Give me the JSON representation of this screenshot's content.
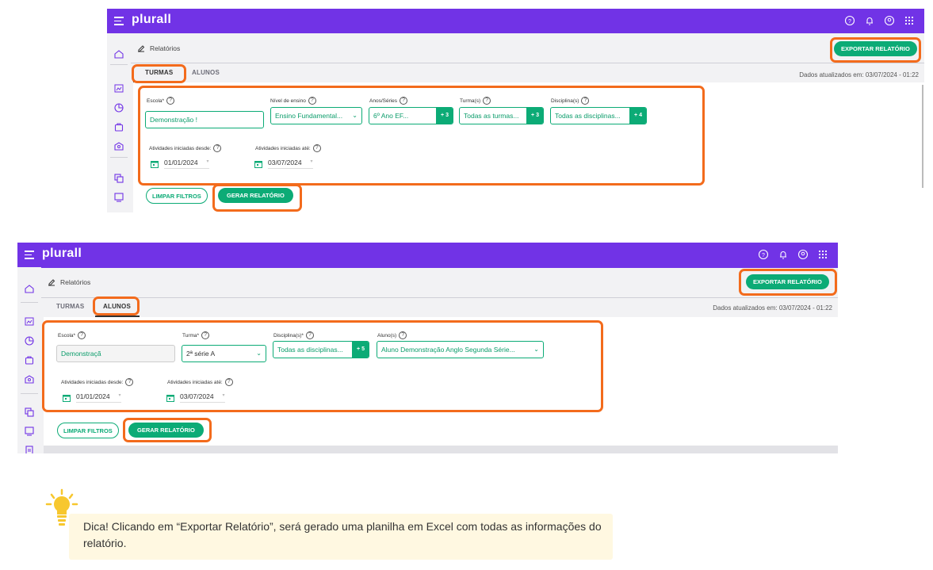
{
  "app": {
    "logo": "plurall"
  },
  "breadcrumb": {
    "title": "Relatórios"
  },
  "export_label": "EXPORTAR RELATÓRIO",
  "updated_text": "Dados atualizados em: 03/07/2024 - 01:22",
  "tabs": {
    "turmas": "TURMAS",
    "alunos": "ALUNOS"
  },
  "buttons": {
    "clear": "LIMPAR FILTROS",
    "generate": "GERAR RELATÓRIO"
  },
  "screen1": {
    "active_tab": "TURMAS",
    "escola": {
      "label": "Escola*",
      "value": "Demonstração !"
    },
    "nivel": {
      "label": "Nível de ensino",
      "value": "Ensino Fundamental..."
    },
    "anos": {
      "label": "Anos/Séries",
      "value": "6º Ano EF...",
      "extra": "+ 3"
    },
    "turmas": {
      "label": "Turma(s)",
      "value": "Todas as turmas...",
      "extra": "+ 3"
    },
    "disciplinas": {
      "label": "Disciplina(s)",
      "value": "Todas as disciplinas...",
      "extra": "+ 4"
    },
    "desde": {
      "label": "Atividades iniciadas desde:",
      "value": "01/01/2024"
    },
    "ate": {
      "label": "Atividades iniciadas até:",
      "value": "03/07/2024"
    }
  },
  "screen2": {
    "active_tab": "ALUNOS",
    "escola": {
      "label": "Escola*",
      "value": "Demonstraçã"
    },
    "turma": {
      "label": "Turma*",
      "value": "2ª série A"
    },
    "disciplinas": {
      "label": "Disciplina(s)*",
      "value": "Todas as disciplinas...",
      "extra": "+ 5"
    },
    "alunos": {
      "label": "Aluno(s)",
      "value": "Aluno Demonstração Anglo Segunda Série..."
    },
    "desde": {
      "label": "Atividades iniciadas desde:",
      "value": "01/01/2024"
    },
    "ate": {
      "label": "Atividades iniciadas até:",
      "value": "03/07/2024"
    }
  },
  "tip": {
    "text": "Dica! Clicando em “Exportar Relatório”, será gerado uma planilha em Excel com todas as informações do relatório."
  },
  "colors": {
    "brand": "#7133e6",
    "accent": "#0cab76",
    "highlight": "#f36b1c",
    "tip_bg": "#fff8e1"
  }
}
